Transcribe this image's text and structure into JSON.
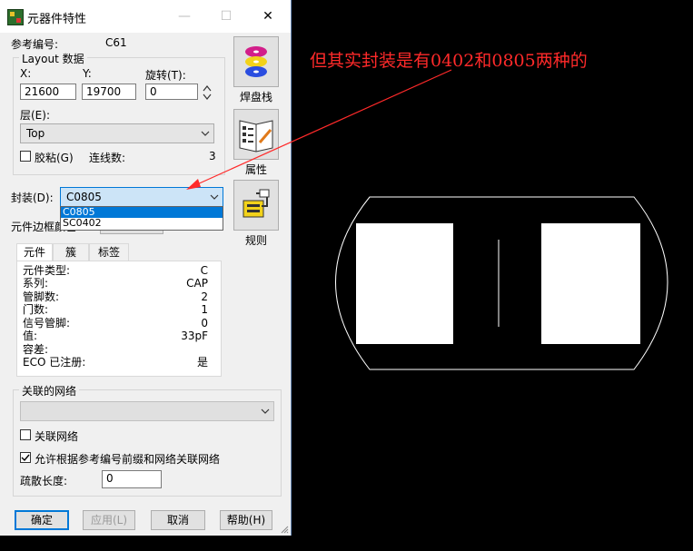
{
  "dialog": {
    "title": "元器件特性",
    "window_controls": {
      "minimize": "—",
      "maximize": "☐",
      "close": "✕"
    },
    "ref_label": "参考编号:",
    "ref_value": "C61",
    "layout_group": {
      "title": "Layout 数据",
      "x_label": "X:",
      "x_value": "21600",
      "y_label": "Y:",
      "y_value": "19700",
      "rot_label": "旋转(T):",
      "rot_value": "0",
      "layer_label": "层(E):",
      "layer_value": "Top",
      "glue_label": "胶粘(G)",
      "glue_checked": false,
      "conn_label": "连线数:",
      "conn_value": "3"
    },
    "package_label": "封装(D):",
    "package_value": "C0805",
    "package_options": [
      "C0805",
      "SC0402"
    ],
    "border_label": "元件边框颜色",
    "tabs": [
      "元件",
      "簇",
      "标签"
    ],
    "props": [
      {
        "k": "元件类型:",
        "v": "C"
      },
      {
        "k": "系列:",
        "v": "CAP"
      },
      {
        "k": "管脚数:",
        "v": "2"
      },
      {
        "k": "门数:",
        "v": "1"
      },
      {
        "k": "信号管脚:",
        "v": "0"
      },
      {
        "k": "值:",
        "v": "33pF"
      },
      {
        "k": "容差:",
        "v": ""
      },
      {
        "k": "ECO 已注册:",
        "v": "是"
      }
    ],
    "net_group_title": "关联的网络",
    "net_select_value": "",
    "assoc_net_label": "关联网络",
    "assoc_net_checked": false,
    "allow_label": "允许根据参考编号前缀和网络关联网络",
    "allow_checked": true,
    "spread_label": "疏散长度:",
    "spread_value": "0",
    "side_buttons": [
      {
        "label": "焊盘栈",
        "icon": "pad-stack-icon"
      },
      {
        "label": "属性",
        "icon": "attributes-book-icon"
      },
      {
        "label": "规则",
        "icon": "rules-icon"
      }
    ],
    "buttons": {
      "ok": "确定",
      "apply": "应用(L)",
      "cancel": "取消",
      "help": "帮助(H)"
    }
  },
  "annotation": {
    "text": "但其实封装是有0402和0805两种的",
    "color": "#ff2a2a"
  },
  "canvas": {
    "background": "#000000",
    "outline_color": "#ffffff",
    "pad_color": "#ffffff"
  },
  "colors": {
    "accent": "#0078d7",
    "dialog_bg": "#f0f0f0"
  }
}
